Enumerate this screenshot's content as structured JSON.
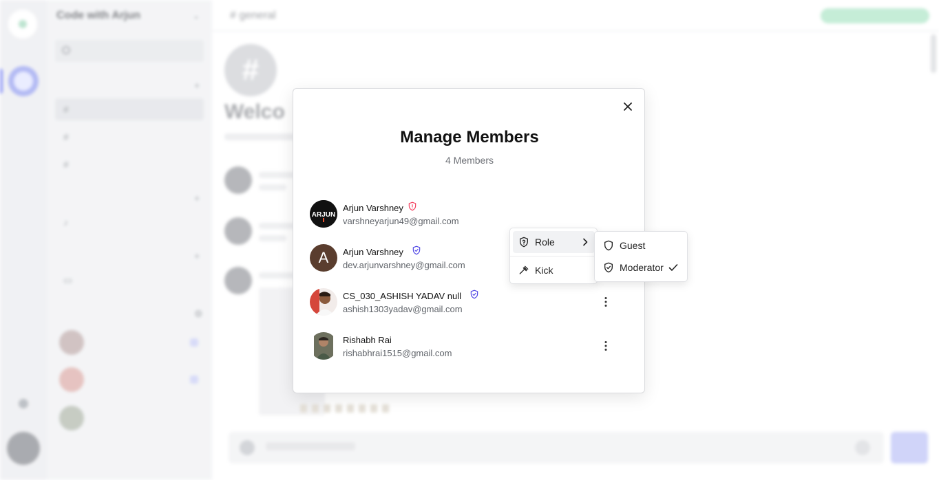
{
  "background": {
    "server_name": "Code with Arjun",
    "header_title": "# general",
    "welcome": "Welco"
  },
  "modal": {
    "title": "Manage Members",
    "subtitle": "4 Members",
    "members": [
      {
        "name": "Arjun Varshney",
        "email": "varshneyarjun49@gmail.com",
        "role": "admin",
        "role_icon": "shield-alert-icon",
        "role_color": "#f43f5e",
        "avatar_text": "ARJUN",
        "has_menu": false
      },
      {
        "name": "Arjun Varshney",
        "email": "dev.arjunvarshney@gmail.com",
        "role": "moderator",
        "role_icon": "shield-check-icon",
        "role_color": "#4f46e5",
        "avatar_text": "A",
        "has_menu": false
      },
      {
        "name": "CS_030_ASHISH YADAV null",
        "email": "ashish1303yadav@gmail.com",
        "role": "moderator",
        "role_icon": "shield-check-icon",
        "role_color": "#4f46e5",
        "avatar_text": "",
        "has_menu": true
      },
      {
        "name": "Rishabh Rai",
        "email": "rishabhrai1515@gmail.com",
        "role": "guest",
        "role_icon": "",
        "avatar_text": "",
        "has_menu": true
      }
    ]
  },
  "dropdown": {
    "role_label": "Role",
    "kick_label": "Kick",
    "submenu": [
      {
        "label": "Guest",
        "icon": "shield-icon",
        "checked": false
      },
      {
        "label": "Moderator",
        "icon": "shield-check-icon",
        "checked": true
      }
    ]
  }
}
